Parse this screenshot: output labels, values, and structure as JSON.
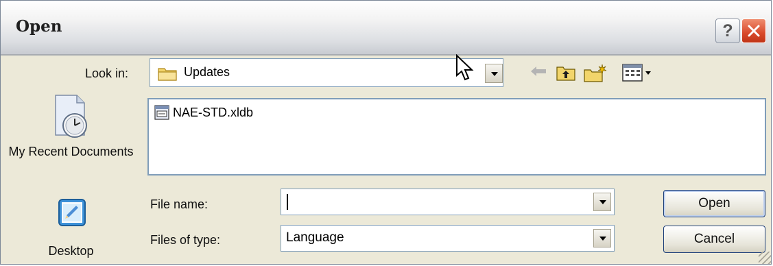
{
  "dialog": {
    "title": "Open",
    "help_symbol": "?",
    "close_symbol": "close"
  },
  "look_in": {
    "label": "Look in:",
    "value": "Updates",
    "folder_icon": "folder-icon"
  },
  "toolbar": {
    "icons": [
      "back-arrow-icon",
      "up-one-level-icon",
      "new-folder-icon",
      "views-menu-icon"
    ]
  },
  "places": [
    {
      "label": "My Recent Documents",
      "icon": "recent-documents-icon"
    },
    {
      "label": "Desktop",
      "icon": "desktop-icon"
    }
  ],
  "files": [
    {
      "name": "NAE-STD.xldb",
      "icon": "database-file-icon"
    }
  ],
  "file_name": {
    "label": "File name:",
    "value": ""
  },
  "file_type": {
    "label": "Files of type:",
    "value": "Language"
  },
  "buttons": {
    "open": "Open",
    "cancel": "Cancel"
  },
  "colors": {
    "dialog_bg": "#ece9d8",
    "field_border": "#7f9db9",
    "close_red": "#d94a2b"
  }
}
